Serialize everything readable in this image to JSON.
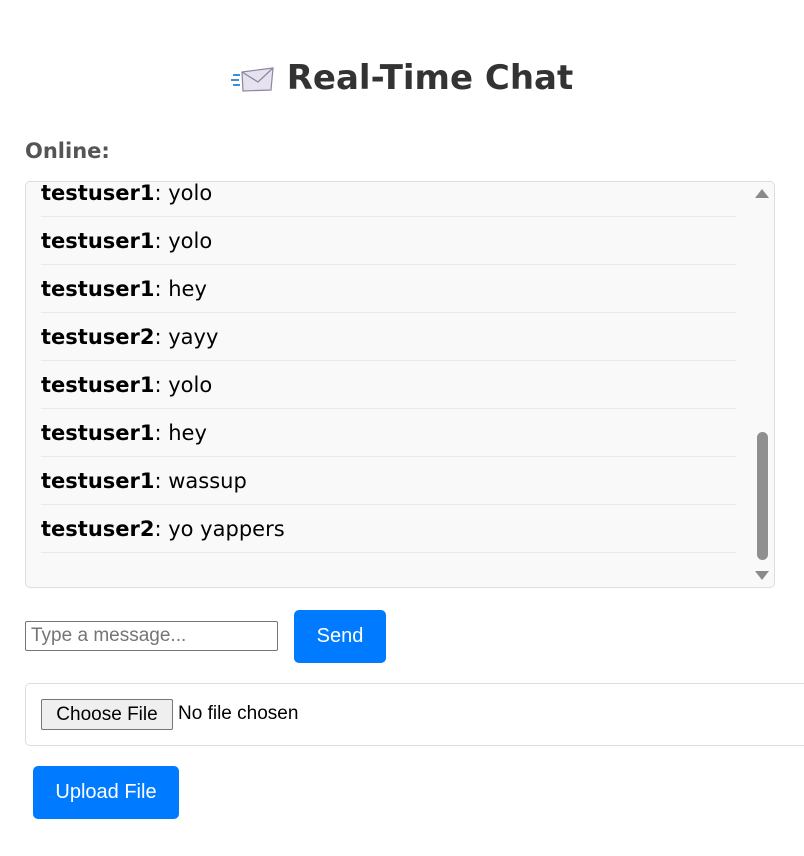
{
  "header": {
    "icon": "incoming-envelope-icon",
    "title": "Real-Time Chat"
  },
  "online": {
    "label": "Online:"
  },
  "chat": {
    "messages": [
      {
        "user": "testuser1",
        "text": ": yolo"
      },
      {
        "user": "testuser1",
        "text": ": yolo"
      },
      {
        "user": "testuser1",
        "text": ": hey"
      },
      {
        "user": "testuser2",
        "text": ": yayy"
      },
      {
        "user": "testuser1",
        "text": ": yolo"
      },
      {
        "user": "testuser1",
        "text": ": hey"
      },
      {
        "user": "testuser1",
        "text": ": wassup"
      },
      {
        "user": "testuser2",
        "text": ": yo yappers"
      }
    ]
  },
  "composer": {
    "placeholder": "Type a message...",
    "value": "",
    "send_label": "Send"
  },
  "file_upload": {
    "choose_label": "Choose File",
    "status": "No file chosen",
    "upload_label": "Upload File"
  },
  "colors": {
    "accent": "#007bff",
    "title": "#333333",
    "label": "#555555",
    "chat_bg": "#f9f9f9"
  }
}
